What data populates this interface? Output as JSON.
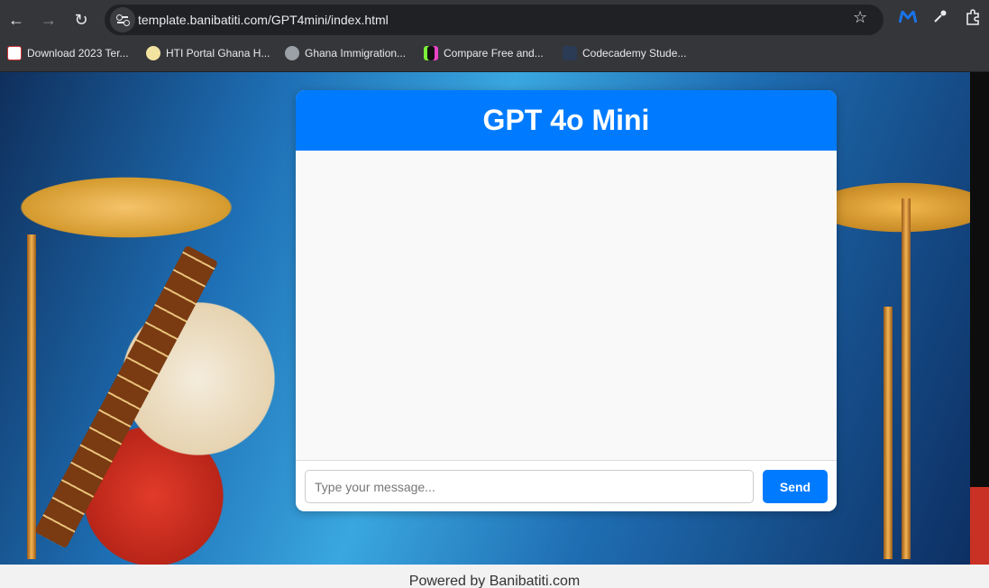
{
  "browser": {
    "url": "template.banibatiti.com/GPT4mini/index.html",
    "bookmarks": [
      {
        "label": "Download 2023 Ter...",
        "icon": "site-favicon-icon"
      },
      {
        "label": "HTI Portal Ghana H...",
        "icon": "portal-favicon-icon"
      },
      {
        "label": "Ghana Immigration...",
        "icon": "globe-icon"
      },
      {
        "label": "Compare Free and...",
        "icon": "compare-favicon-icon"
      },
      {
        "label": "Codecademy Stude...",
        "icon": "codecademy-favicon-icon"
      }
    ]
  },
  "chat": {
    "title": "GPT 4o Mini",
    "input_placeholder": "Type your message...",
    "input_value": "",
    "send_label": "Send"
  },
  "footer": {
    "text": "Powered by Banibatiti.com"
  },
  "colors": {
    "accent": "#007bff",
    "chrome": "#35363a",
    "omnibox": "#202124"
  }
}
